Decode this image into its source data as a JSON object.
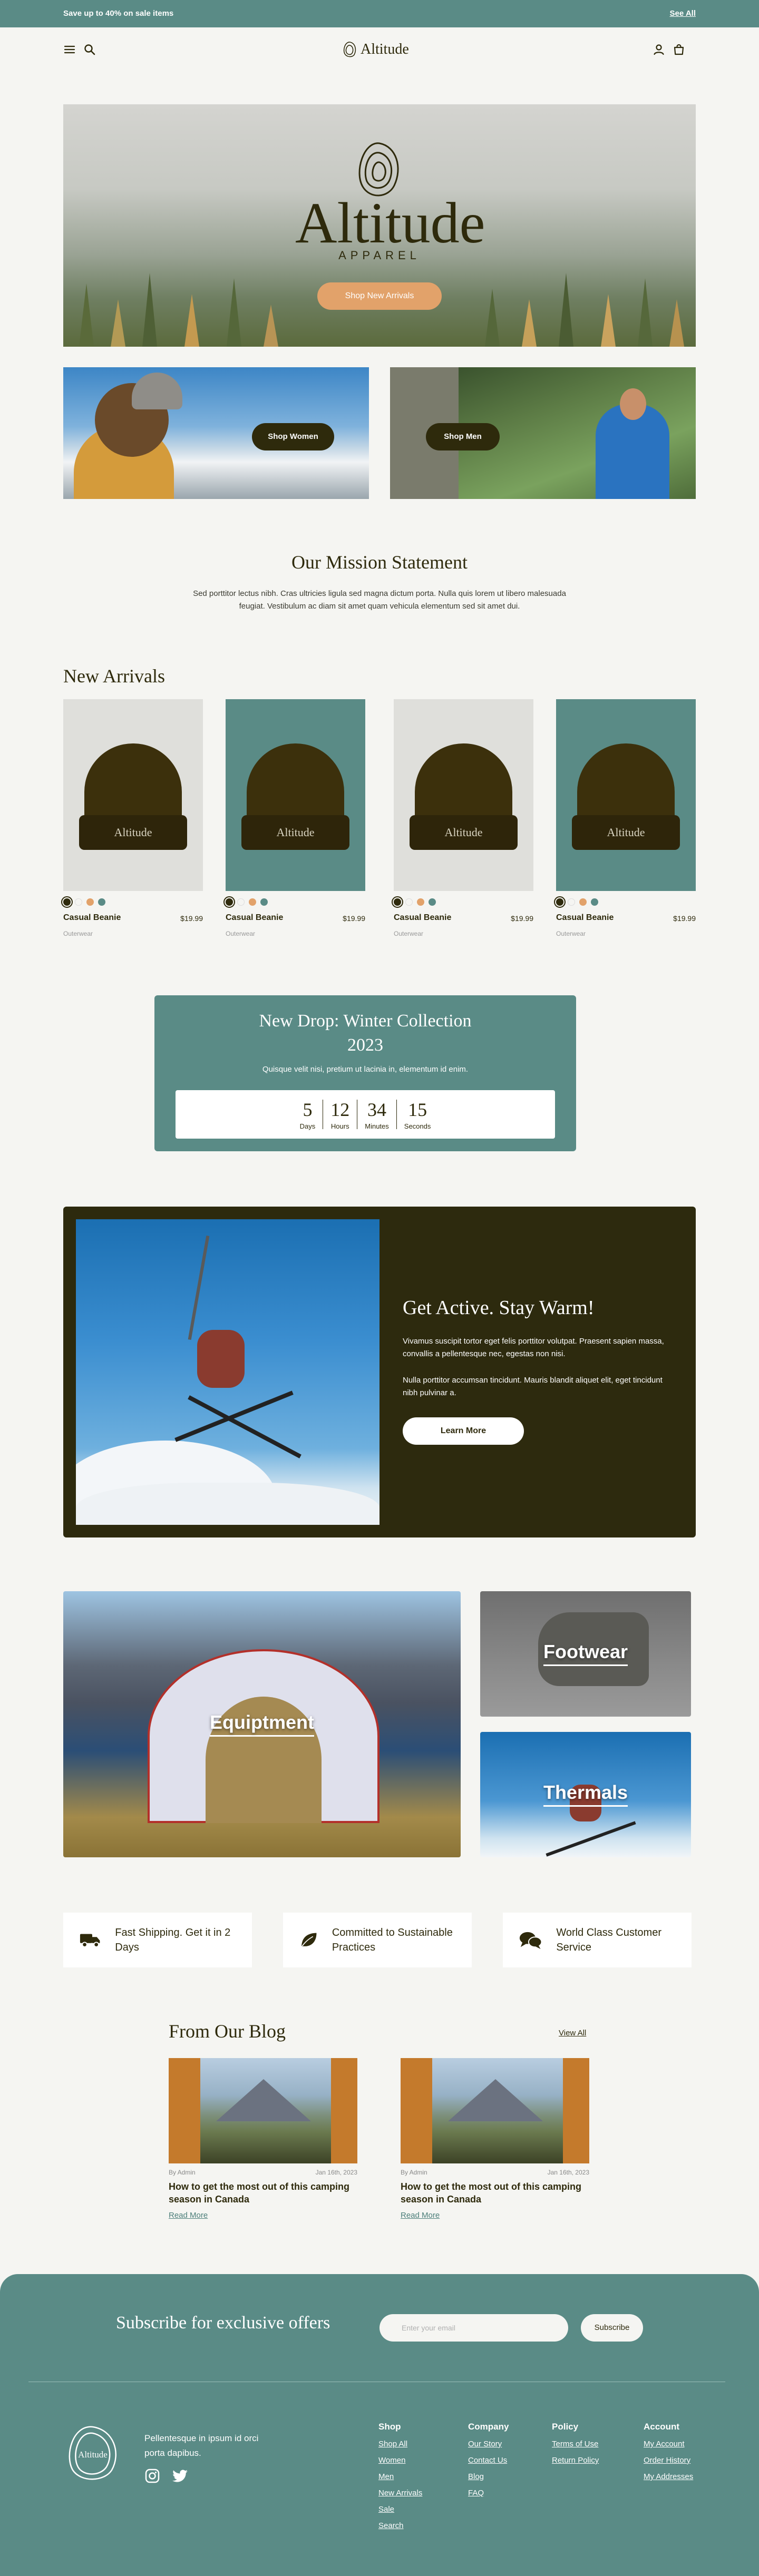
{
  "announcement": {
    "message": "Save up to 40% on sale items",
    "link": "See All"
  },
  "header": {
    "brand": "Altitude"
  },
  "hero": {
    "brand_big": "Altitude",
    "brand_sub": "APPAREL",
    "cta": "Shop New Arrivals"
  },
  "promos": [
    {
      "label": "Shop Women"
    },
    {
      "label": "Shop Men"
    }
  ],
  "mission": {
    "title": "Our Mission Statement",
    "text": "Sed porttitor lectus nibh. Cras ultricies ligula sed magna dictum porta. Nulla quis lorem ut libero malesuada feugiat. Vestibulum ac diam sit amet quam vehicula elementum sed sit amet dui."
  },
  "new_arrivals": {
    "title": "New Arrivals",
    "products": [
      {
        "name": "Casual Beanie",
        "price": "$19.99",
        "category": "Outerwear",
        "logo": "Altitude"
      },
      {
        "name": "Casual Beanie",
        "price": "$19.99",
        "category": "Outerwear",
        "logo": "Altitude"
      },
      {
        "name": "Casual Beanie",
        "price": "$19.99",
        "category": "Outerwear",
        "logo": "Altitude"
      },
      {
        "name": "Casual Beanie",
        "price": "$19.99",
        "category": "Outerwear",
        "logo": "Altitude"
      }
    ],
    "swatch_colors": [
      "#2e2a0c",
      "#f5f5f2",
      "#e2a26a",
      "#5a8b86"
    ]
  },
  "drop": {
    "title_line1": "New Drop: Winter Collection",
    "title_line2": "2023",
    "desc": "Quisque velit nisi, pretium ut lacinia in, elementum id enim.",
    "countdown": [
      {
        "value": "5",
        "label": "Days"
      },
      {
        "value": "12",
        "label": "Hours"
      },
      {
        "value": "34",
        "label": "Minutes"
      },
      {
        "value": "15",
        "label": "Seconds"
      }
    ]
  },
  "active": {
    "title": "Get Active. Stay Warm!",
    "p1": "Vivamus suscipit tortor eget felis porttitor volutpat. Praesent sapien massa, convallis a pellentesque nec, egestas non nisi.",
    "p2": "Nulla porttitor accumsan tincidunt. Mauris blandit aliquet elit, eget tincidunt nibh pulvinar a.",
    "cta": "Learn More"
  },
  "categories": {
    "equipment": "Equiptment",
    "footwear": "Footwear",
    "thermals": "Thermals"
  },
  "features": [
    {
      "text": "Fast Shipping. Get it in 2 Days",
      "icon": "truck-icon"
    },
    {
      "text": "Committed to Sustainable Practices",
      "icon": "leaf-icon"
    },
    {
      "text": "World Class Customer Service",
      "icon": "chat-icon"
    }
  ],
  "blog": {
    "title": "From Our Blog",
    "view_all": "View All",
    "posts": [
      {
        "author": "By Admin",
        "date": "Jan 16th, 2023",
        "title": "How to get the most out of this camping season in Canada",
        "read_more": "Read More"
      },
      {
        "author": "By Admin",
        "date": "Jan 16th, 2023",
        "title": "How to get the most out of this camping season in Canada",
        "read_more": "Read More"
      }
    ]
  },
  "footer": {
    "subscribe_title": "Subscribe for exclusive offers",
    "email_placeholder": "Enter your email",
    "subscribe_button": "Subscribe",
    "logo_text": "Altitude",
    "desc": "Pellentesque in ipsum id orci porta dapibus.",
    "columns": [
      {
        "heading": "Shop",
        "links": [
          "Shop All",
          "Women",
          "Men",
          "New Arrivals",
          "Sale",
          "Search"
        ]
      },
      {
        "heading": "Company",
        "links": [
          "Our Story",
          "Contact Us",
          "Blog",
          "FAQ"
        ]
      },
      {
        "heading": "Policy",
        "links": [
          "Terms of Use",
          "Return Policy"
        ]
      },
      {
        "heading": "Account",
        "links": [
          "My Account",
          "Order History",
          "My Addresses"
        ]
      }
    ]
  }
}
